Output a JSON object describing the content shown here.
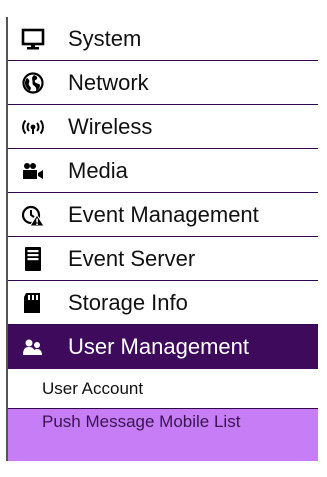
{
  "menu": {
    "items": [
      {
        "label": "System",
        "icon": "monitor-icon"
      },
      {
        "label": "Network",
        "icon": "globe-icon"
      },
      {
        "label": "Wireless",
        "icon": "wireless-icon"
      },
      {
        "label": "Media",
        "icon": "media-icon"
      },
      {
        "label": "Event Management",
        "icon": "event-alarm-icon"
      },
      {
        "label": "Event Server",
        "icon": "server-icon"
      },
      {
        "label": "Storage Info",
        "icon": "sd-card-icon"
      },
      {
        "label": "User Management",
        "icon": "users-icon"
      }
    ],
    "subitems": [
      {
        "label": "User Account"
      },
      {
        "label": "Push Message Mobile List"
      }
    ]
  },
  "colors": {
    "active_bg": "#3d0a5c",
    "highlight_bg": "#c77df5",
    "border": "#2e0a4a"
  }
}
